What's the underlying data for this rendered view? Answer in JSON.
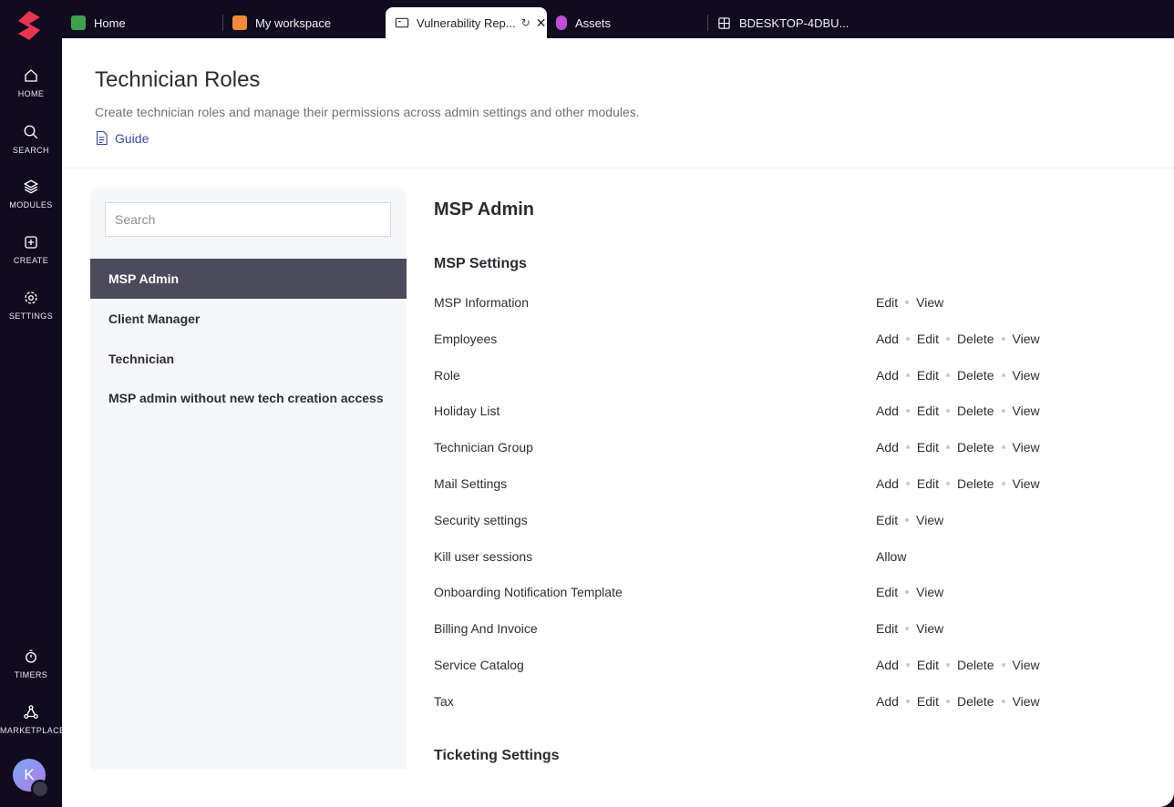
{
  "rail": {
    "items": [
      {
        "label": "HOME",
        "icon": "home-icon"
      },
      {
        "label": "SEARCH",
        "icon": "search-icon"
      },
      {
        "label": "MODULES",
        "icon": "layers-icon"
      },
      {
        "label": "CREATE",
        "icon": "plus-square-icon"
      },
      {
        "label": "SETTINGS",
        "icon": "gear-icon"
      },
      {
        "label": "TIMERS",
        "icon": "stopwatch-icon"
      },
      {
        "label": "MARKETPLACE",
        "icon": "nodes-icon"
      }
    ],
    "avatar_initial": "K"
  },
  "tabs": [
    {
      "label": "Home",
      "icon_color": "#3aa34b"
    },
    {
      "label": "My workspace",
      "icon_color": "#f08a3a"
    },
    {
      "label": "Vulnerability Rep...",
      "active": true
    },
    {
      "label": "Assets",
      "icon_color": "#c04cd8"
    },
    {
      "label": "BDESKTOP-4DBU..."
    }
  ],
  "header": {
    "title": "Technician Roles",
    "subtitle": "Create technician roles and manage their permissions across admin settings and other modules.",
    "guide_label": "Guide"
  },
  "roles": {
    "search_placeholder": "Search",
    "items": [
      {
        "label": "MSP Admin",
        "active": true
      },
      {
        "label": "Client Manager"
      },
      {
        "label": "Technician"
      },
      {
        "label": "MSP admin without new tech creation access"
      }
    ]
  },
  "detail": {
    "role_title": "MSP Admin",
    "section_title": "MSP Settings",
    "permissions": [
      {
        "name": "MSP Information",
        "actions": [
          "Edit",
          "View"
        ]
      },
      {
        "name": "Employees",
        "actions": [
          "Add",
          "Edit",
          "Delete",
          "View"
        ]
      },
      {
        "name": "Role",
        "actions": [
          "Add",
          "Edit",
          "Delete",
          "View"
        ]
      },
      {
        "name": "Holiday List",
        "actions": [
          "Add",
          "Edit",
          "Delete",
          "View"
        ]
      },
      {
        "name": "Technician Group",
        "actions": [
          "Add",
          "Edit",
          "Delete",
          "View"
        ]
      },
      {
        "name": "Mail Settings",
        "actions": [
          "Add",
          "Edit",
          "Delete",
          "View"
        ]
      },
      {
        "name": "Security settings",
        "actions": [
          "Edit",
          "View"
        ]
      },
      {
        "name": "Kill user sessions",
        "actions": [
          "Allow"
        ]
      },
      {
        "name": "Onboarding Notification Template",
        "actions": [
          "Edit",
          "View"
        ]
      },
      {
        "name": "Billing And Invoice",
        "actions": [
          "Edit",
          "View"
        ]
      },
      {
        "name": "Service Catalog",
        "actions": [
          "Add",
          "Edit",
          "Delete",
          "View"
        ]
      },
      {
        "name": "Tax",
        "actions": [
          "Add",
          "Edit",
          "Delete",
          "View"
        ]
      }
    ],
    "next_section_title": "Ticketing Settings"
  }
}
